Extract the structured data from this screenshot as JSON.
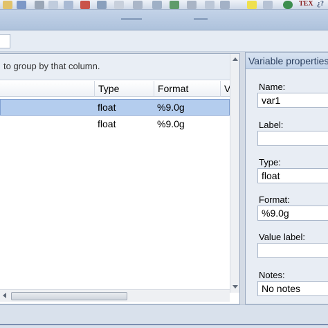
{
  "toolbar": {
    "tex_label": "TEX",
    "help_label": "¿?"
  },
  "variables_panel": {
    "group_hint": "to group by that column.",
    "columns": [
      "Type",
      "Format",
      "V"
    ],
    "rows": [
      {
        "type": "float",
        "format": "%9.0g",
        "selected": true
      },
      {
        "type": "float",
        "format": "%9.0g",
        "selected": false
      }
    ]
  },
  "properties_panel": {
    "title": "Variable properties",
    "name_label": "Name:",
    "name_value": "var1",
    "label_label": "Label:",
    "label_value": "",
    "type_label": "Type:",
    "type_value": "float",
    "format_label": "Format:",
    "format_value": "%9.0g",
    "value_label_label": "Value label:",
    "value_label_value": "",
    "notes_label": "Notes:",
    "notes_value": "No notes"
  },
  "colors": {
    "selection": "#b4cdee",
    "panel_title": "#2a3f5f"
  }
}
